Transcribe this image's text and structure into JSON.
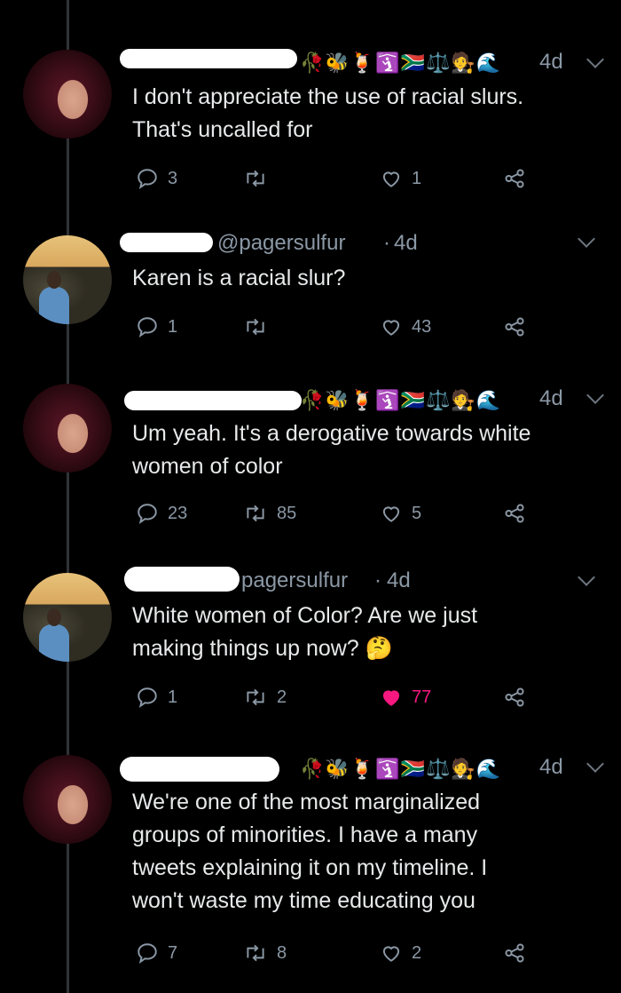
{
  "tweets": [
    {
      "avatar": "woman-avatar",
      "handle": "",
      "time": "4d",
      "emoji": "🥀🐝🍹🛐🇿🇦⚖️🧑‍⚖️🌊",
      "text": "I don't appreciate the use of racial slurs.\nThat's uncalled for",
      "replies": "3",
      "retweets": "",
      "likes": "1",
      "liked": false
    },
    {
      "avatar": "man-avatar",
      "handle": "@pagersulfur",
      "time": "4d",
      "emoji": "",
      "text": "Karen is a racial slur?",
      "replies": "1",
      "retweets": "",
      "likes": "43",
      "liked": false
    },
    {
      "avatar": "woman-avatar",
      "handle": "",
      "time": "4d",
      "emoji": "🥀🐝🍹🛐🇿🇦⚖️🧑‍⚖️🌊",
      "text": "Um yeah. It's a derogative towards white\nwomen of color",
      "replies": "23",
      "retweets": "85",
      "likes": "5",
      "liked": false
    },
    {
      "avatar": "man-avatar",
      "handle": "pagersulfur",
      "time": "4d",
      "emoji": "",
      "text": "White women of Color? Are we just\nmaking things up now? 🤔",
      "replies": "1",
      "retweets": "2",
      "likes": "77",
      "liked": true
    },
    {
      "avatar": "woman-avatar",
      "handle": "",
      "time": "4d",
      "emoji": "🥀🐝🍹🛐🇿🇦⚖️🧑‍⚖️🌊",
      "text": "We're one of the most marginalized\ngroups of minorities. I have a many\ntweets explaining it on my timeline. I\nwon't waste my time educating you",
      "replies": "7",
      "retweets": "8",
      "likes": "2",
      "liked": false
    }
  ],
  "separator": "·",
  "colors": {
    "background": "#000000",
    "text": "#e7e9ea",
    "muted": "#8b98a5",
    "like": "#f91880"
  }
}
